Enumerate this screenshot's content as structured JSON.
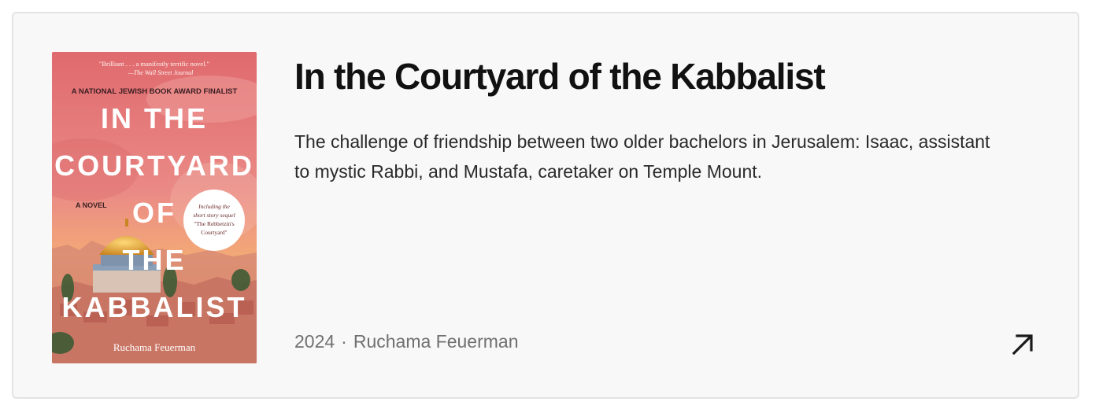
{
  "book": {
    "title": "In the Courtyard of the Kabbalist",
    "description": "The challenge of friendship between two older bachelors in Jerusalem: Isaac, assistant to mystic Rabbi, and Mustafa, caretaker on Temple Mount.",
    "year": "2024",
    "separator": "·",
    "author": "Ruchama Feuerman",
    "link_icon": "arrow-up-right-icon"
  },
  "cover": {
    "quote": "\"Brilliant . . . a manifestly terrific novel.\"",
    "quote_source": "—The Wall Street Journal",
    "award": "A NATIONAL JEWISH BOOK AWARD FINALIST",
    "title_lines": [
      "IN THE",
      "COURTYARD",
      "OF",
      "THE",
      "KABBALIST"
    ],
    "genre": "A NOVEL",
    "badge_lines": [
      "Including the",
      "short story sequel",
      "\"The Rebbetzin's",
      "Courtyard\""
    ],
    "author": "Ruchama Feuerman"
  },
  "colors": {
    "card_bg": "#f8f8f8",
    "card_border": "#e3e3e3",
    "cover_top": "#e8787a",
    "cover_bottom": "#f0a05a",
    "dome": "#e8a93a"
  }
}
